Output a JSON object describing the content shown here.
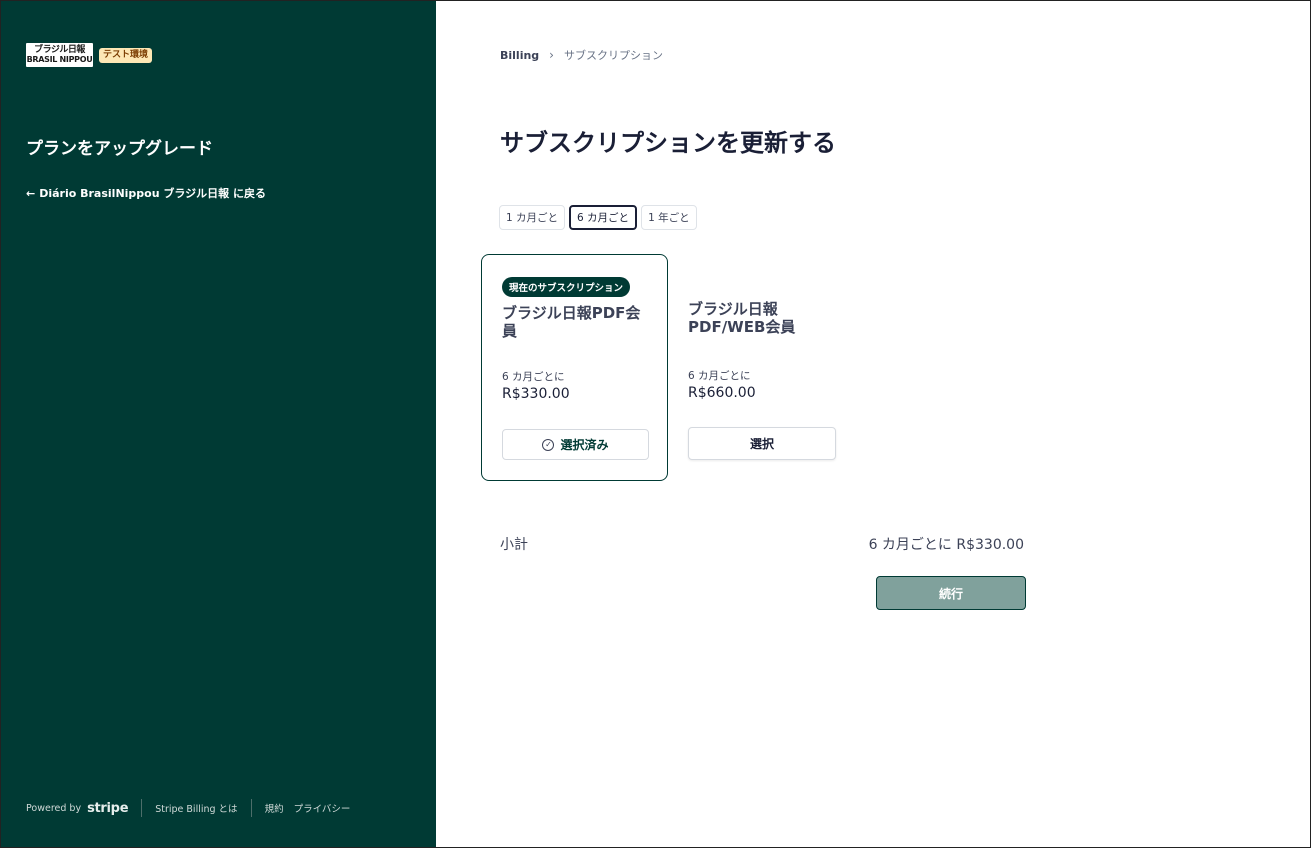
{
  "sidebar": {
    "logo": {
      "line1": "ブラジル日報",
      "line2": "BRASIL NIPPOU"
    },
    "test_badge": "テスト環境",
    "title": "プランをアップグレード",
    "back_link": "Diário BrasilNippou ブラジル日報 に戻る",
    "footer": {
      "powered_by": "Powered by",
      "stripe": "stripe",
      "stripe_billing": "Stripe Billing とは",
      "terms": "規約",
      "privacy": "プライバシー"
    }
  },
  "breadcrumb": {
    "root": "Billing",
    "current": "サブスクリプション"
  },
  "page_title": "サブスクリプションを更新する",
  "intervals": [
    {
      "label": "1 カ月ごと",
      "active": false
    },
    {
      "label": "6 カ月ごと",
      "active": true
    },
    {
      "label": "1 年ごと",
      "active": false
    }
  ],
  "plans": [
    {
      "badge": "現在のサブスクリプション",
      "name": "ブラジル日報PDF会員",
      "interval": "6 カ月ごとに",
      "price": "R$330.00",
      "button": "選択済み",
      "current": true
    },
    {
      "name": "ブラジル日報 PDF/WEB会員",
      "interval": "6 カ月ごとに",
      "price": "R$660.00",
      "button": "選択",
      "current": false
    }
  ],
  "summary": {
    "subtotal_label": "小計",
    "subtotal_value": "6 カ月ごとに R$330.00",
    "continue": "続行"
  },
  "colors": {
    "sidebar_bg": "#003a34",
    "continue_bg": "#80a19c",
    "badge_bg": "#fde7b5"
  },
  "icons": [
    "arrow-left-icon",
    "chevron-right-icon",
    "check-circle-icon"
  ]
}
